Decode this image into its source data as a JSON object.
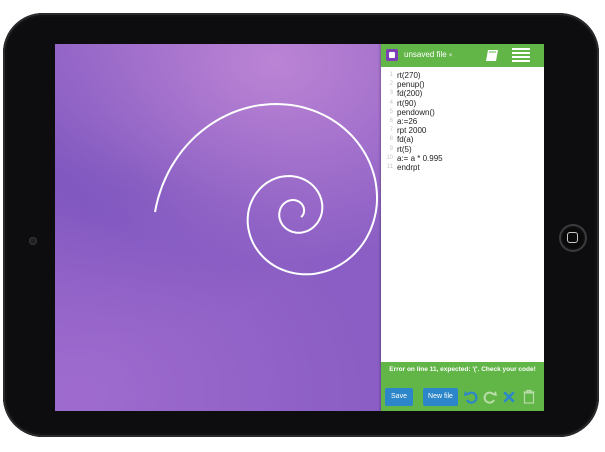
{
  "header": {
    "file_tab": "unsaved file",
    "close_glyph": "×",
    "icons": [
      "app-icon",
      "book-icon",
      "menu-icon"
    ]
  },
  "code": {
    "lines": [
      {
        "num": "1",
        "text": "rt(270)"
      },
      {
        "num": "2",
        "text": "penup()"
      },
      {
        "num": "3",
        "text": "fd(200)"
      },
      {
        "num": "4",
        "text": "rt(90)"
      },
      {
        "num": "5",
        "text": "pendown()"
      },
      {
        "num": "6",
        "text": "a:=26"
      },
      {
        "num": "7",
        "text": "rpt 2000"
      },
      {
        "num": "8",
        "text": "fd(a)"
      },
      {
        "num": "9",
        "text": "rt(5)"
      },
      {
        "num": "10",
        "text": "a:= a * 0.995"
      },
      {
        "num": "11",
        "text": "endrpt"
      }
    ]
  },
  "error": {
    "message": "Error on line 11, expected: '('. Check your code!"
  },
  "toolbar": {
    "save_label": "Save",
    "new_file_label": "New file",
    "icons": [
      "undo-icon",
      "redo-icon",
      "clear-icon",
      "trash-icon"
    ]
  },
  "colors": {
    "panel_green": "#62b547",
    "button_blue": "#2c86c9",
    "canvas_purple": "#8a5ec4",
    "app_icon_purple": "#7d3fb6"
  }
}
